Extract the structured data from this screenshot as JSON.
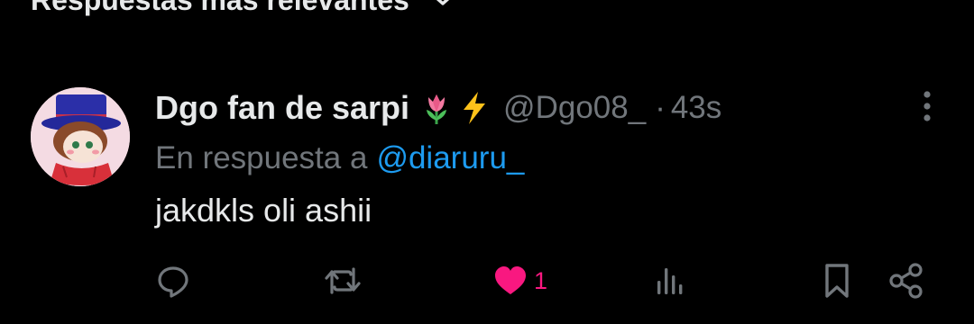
{
  "sort_header": {
    "label": "Respuestas más relevantes",
    "icon": "chevron-down-icon"
  },
  "reply": {
    "display_name": "Dgo fan de sarpi",
    "name_emojis": [
      "tulip-emoji",
      "lightning-emoji"
    ],
    "handle": "@Dgo08_",
    "separator": "·",
    "time": "43s",
    "reply_prefix": "En respuesta a",
    "reply_to": "@diaruru_",
    "text": "jakdkls oli ashii",
    "actions": {
      "reply_icon": "comment-bubble-icon",
      "repost_icon": "repost-icon",
      "like_icon": "heart-filled-icon",
      "like_count": "1",
      "liked": true,
      "views_icon": "views-bar-chart-icon",
      "bookmark_icon": "bookmark-icon",
      "share_icon": "share-icon"
    }
  },
  "colors": {
    "background": "#000000",
    "primary_text": "#e7e9ea",
    "secondary_text": "#71767b",
    "accent_blue": "#1d9bf0",
    "like_pink": "#f91880"
  }
}
